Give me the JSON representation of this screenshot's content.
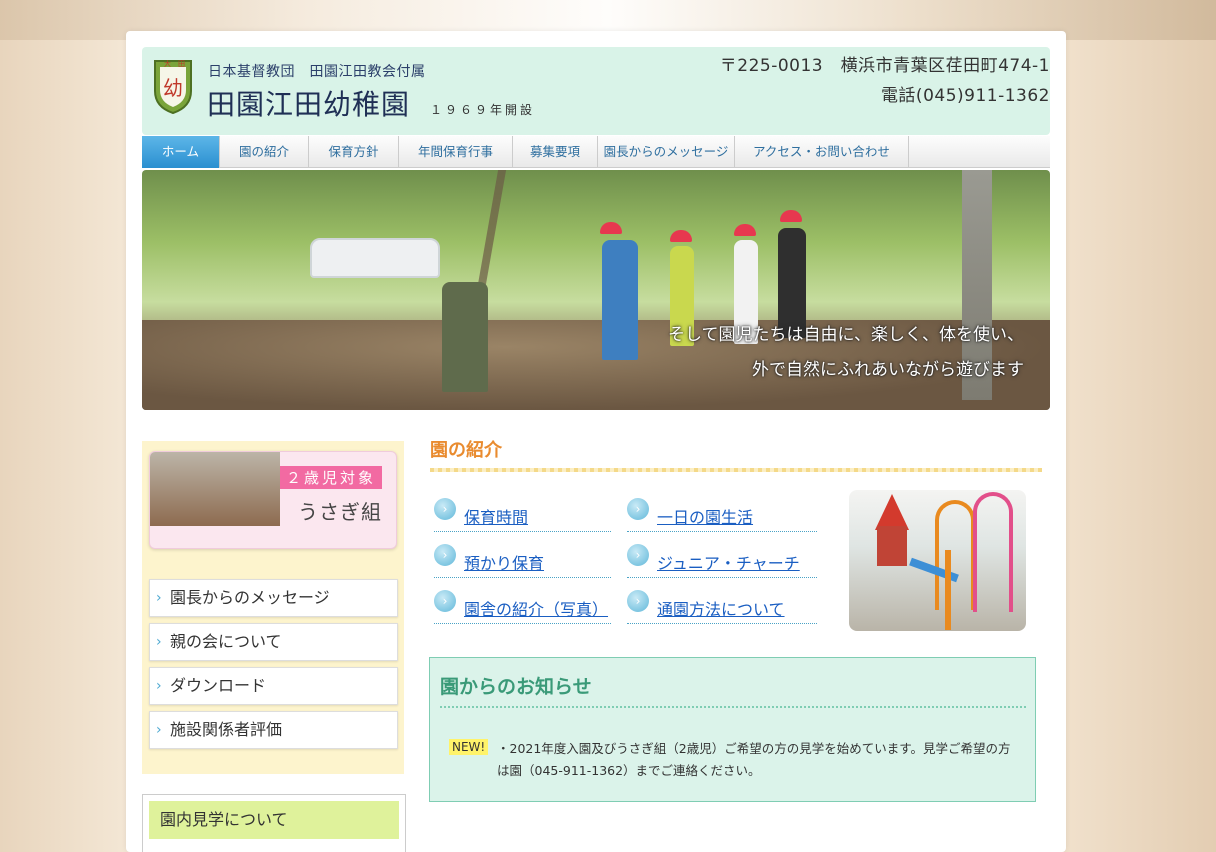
{
  "colors": {
    "accent_blue": "#2a8fd0",
    "header_bg": "#d9f3e8",
    "section_orange": "#e98b2f",
    "notice_green": "#3a9a78",
    "sidebar_bg": "#fdf4cd"
  },
  "header": {
    "org": "日本基督教団　田園江田教会付属",
    "title": "田園江田幼稚園",
    "founded": "１９６９年開設",
    "address": "〒225-0013　横浜市青葉区荏田町474-1",
    "phone": "電話(045)911-1362",
    "logo_icon": "school-crest-icon"
  },
  "nav": {
    "items": [
      {
        "label": "ホーム"
      },
      {
        "label": "園の紹介"
      },
      {
        "label": "保育方針"
      },
      {
        "label": "年間保育行事"
      },
      {
        "label": "募集要項"
      },
      {
        "label": "園長からのメッセージ"
      },
      {
        "label": "アクセス・お問い合わせ"
      }
    ]
  },
  "hero": {
    "line1": "そして園児たちは自由に、楽しく、体を使い、",
    "line2": "外で自然にふれあいながら遊びます"
  },
  "sidebar": {
    "usagi_badge": "２歳児対象",
    "usagi_label": "うさぎ組",
    "links": [
      {
        "label": "園長からのメッセージ"
      },
      {
        "label": "親の会について"
      },
      {
        "label": "ダウンロード"
      },
      {
        "label": "施設関係者評価"
      }
    ],
    "visit_label": "園内見学について"
  },
  "intro": {
    "title": "園の紹介",
    "links": [
      {
        "label": "保育時間"
      },
      {
        "label": "一日の園生活"
      },
      {
        "label": "預かり保育"
      },
      {
        "label": "ジュニア・チャーチ"
      },
      {
        "label": "園舎の紹介（写真）"
      },
      {
        "label": "通園方法について"
      }
    ]
  },
  "notice": {
    "title": "園からのお知らせ",
    "badge": "NEW!",
    "text": "・2021年度入園及びうさぎ組（2歳児）ご希望の方の見学を始めています。見学ご希望の方は園（045-911-1362）までご連絡ください。"
  }
}
